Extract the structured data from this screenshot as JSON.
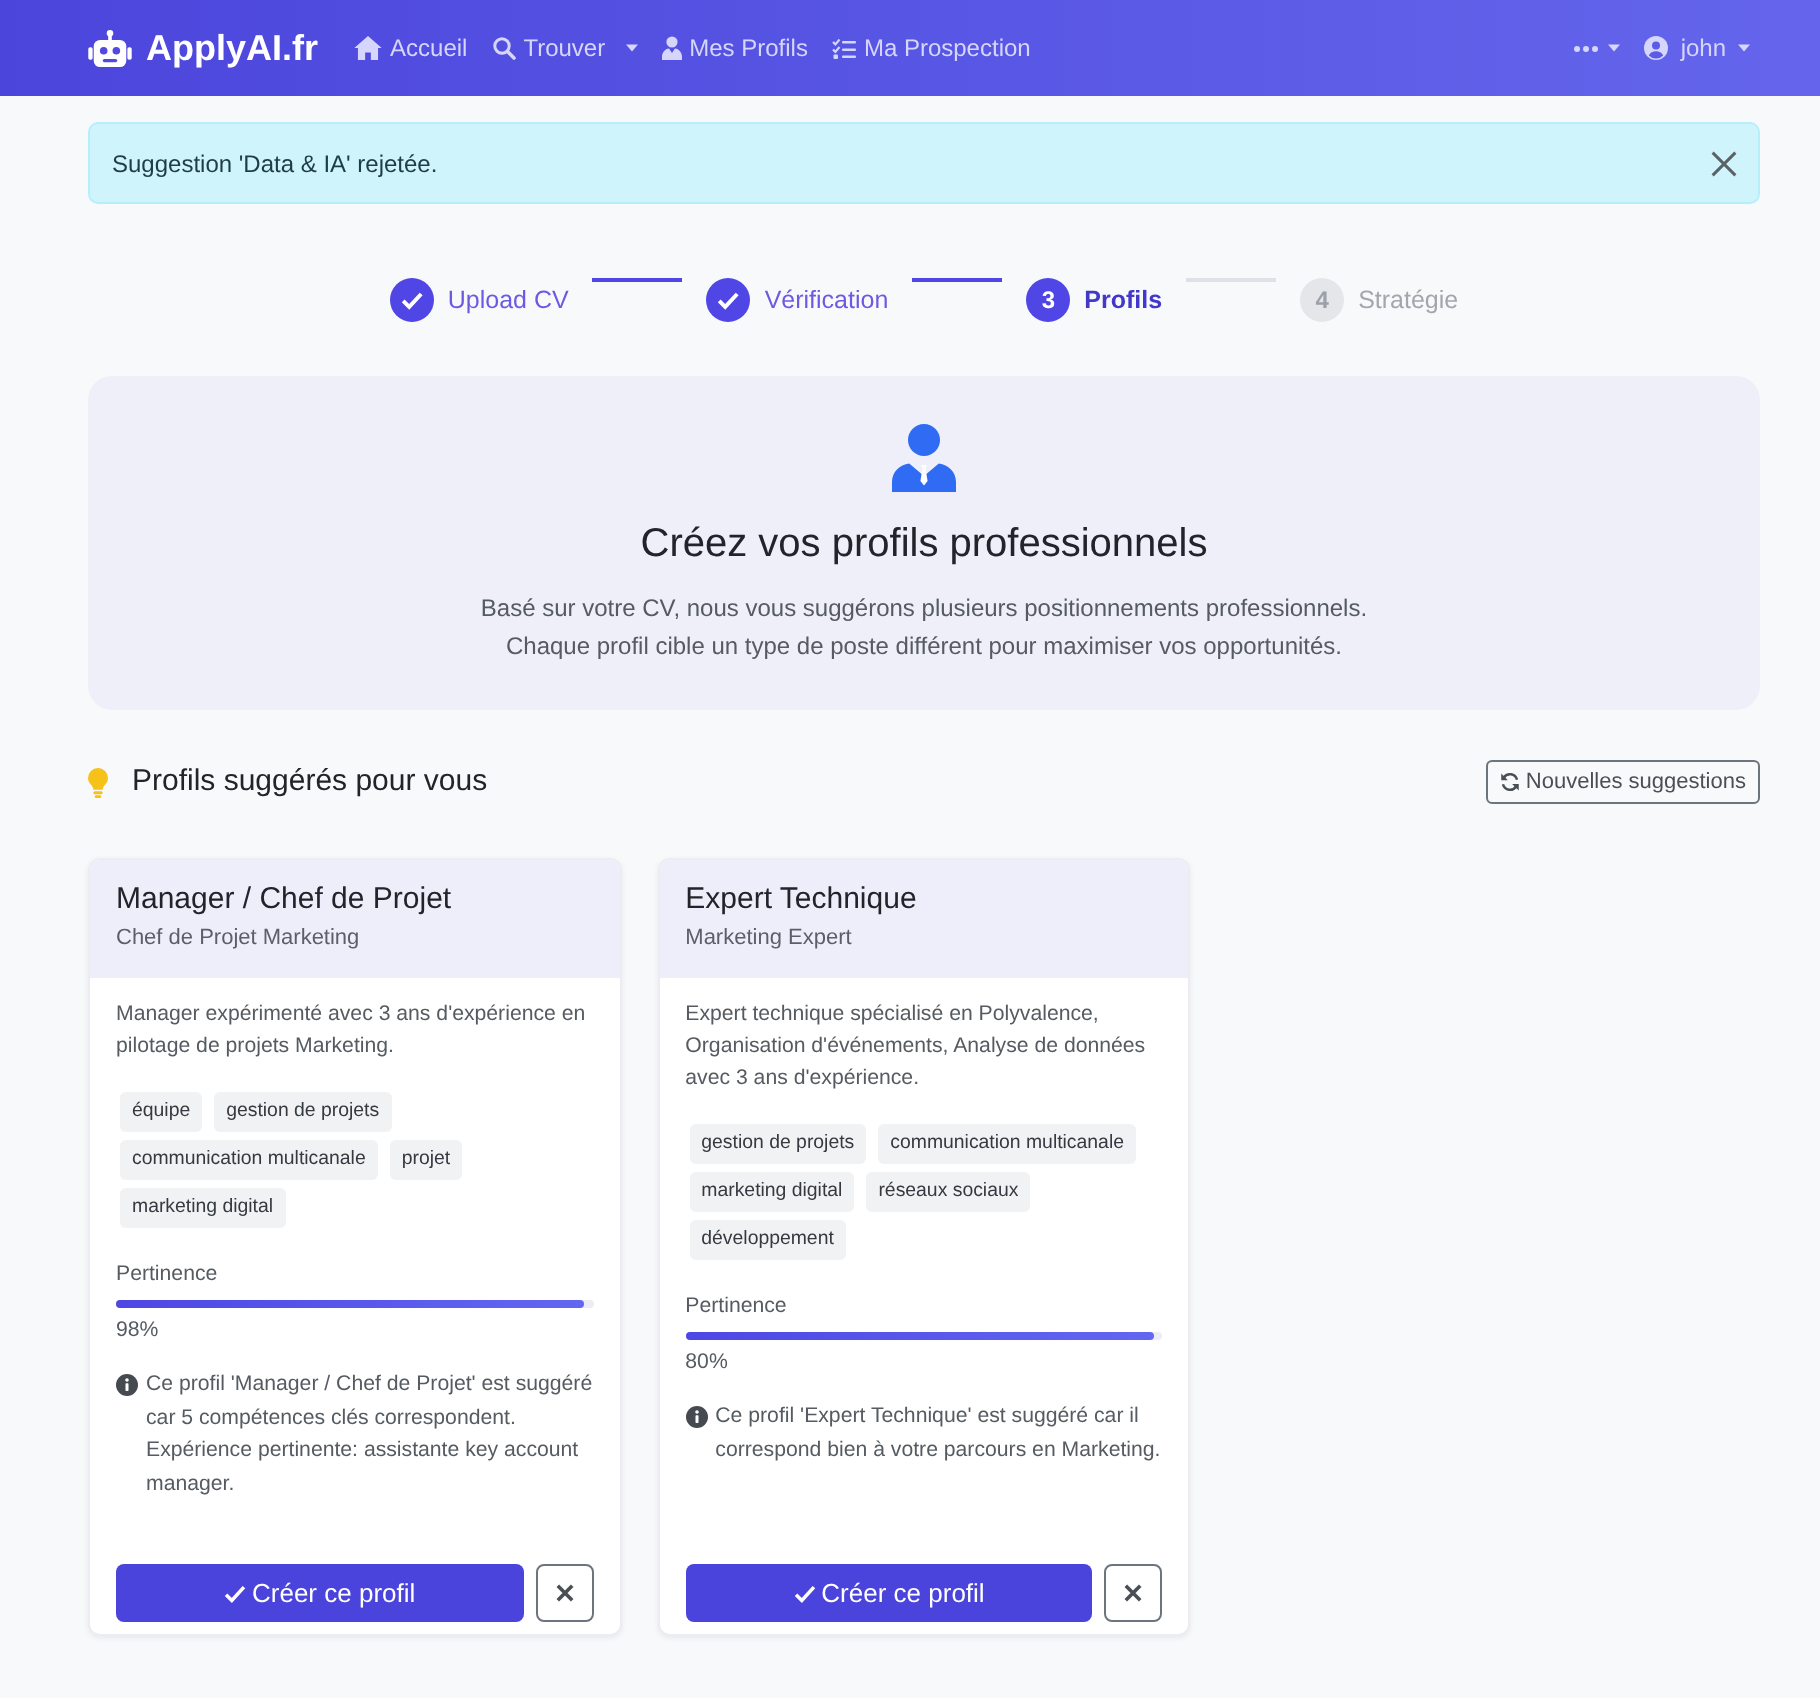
{
  "navbar": {
    "brand": "ApplyAI.fr",
    "links": [
      {
        "kind": "home",
        "label": "Accueil",
        "dropdown": false
      },
      {
        "kind": "search",
        "label": "Trouver",
        "dropdown": true
      },
      {
        "kind": "profiles",
        "label": "Mes Profils",
        "dropdown": false
      },
      {
        "kind": "prospection",
        "label": "Ma Prospection",
        "dropdown": false
      }
    ],
    "user": {
      "name": "john"
    }
  },
  "alert": {
    "message": "Suggestion 'Data & IA' rejetée.",
    "dismissible": true
  },
  "stepper": {
    "steps": [
      {
        "label": "Upload CV",
        "done": true,
        "selected": false
      },
      {
        "label": "Vérification",
        "done": true,
        "selected": false
      },
      {
        "number": "3",
        "label": "Profils",
        "done": false,
        "selected": true
      },
      {
        "number": "4",
        "label": "Stratégie",
        "done": false,
        "selected": false
      }
    ]
  },
  "hero": {
    "title": "Créez vos profils professionnels",
    "lines": [
      "Basé sur votre CV, nous vous suggérons plusieurs positionnements professionnels.",
      "Chaque profil cible un type de poste différent pour maximiser vos opportunités."
    ]
  },
  "suggestions": {
    "title": "Profils suggérés pour vous",
    "refresh_button": "Nouvelles suggestions",
    "profiles": [
      {
        "title": "Manager / Chef de Projet",
        "subtitle": "Chef de Projet Marketing",
        "description": "Manager expérimenté avec 3 ans d'expérience en pilotage de projets Marketing.",
        "skills": [
          "équipe",
          "gestion de projets",
          "communication multicanale",
          "projet",
          "marketing digital"
        ],
        "relevance_label": "Pertinence",
        "level": 0.98,
        "relevance": "98%",
        "reason": "Ce profil 'Manager / Chef de Projet' est suggéré car 5 compétences clés correspondent. Expérience pertinente: assistante key account manager.",
        "create_button": "Créer ce profil"
      },
      {
        "title": "Expert Technique",
        "subtitle": "Marketing Expert",
        "description": "Expert technique spécialisé en Polyvalence, Organisation d'événements, Analyse de données avec 3 ans d'expérience.",
        "skills": [
          "gestion de projets",
          "communication multicanale",
          "marketing digital",
          "réseaux sociaux",
          "développement"
        ],
        "relevance_label": "Pertinence",
        "level": 0.98,
        "relevance": "80%",
        "reason": "Ce profil 'Expert Technique' est suggéré car il correspond bien à votre parcours en Marketing.",
        "create_button": "Créer ce profil"
      }
    ]
  }
}
